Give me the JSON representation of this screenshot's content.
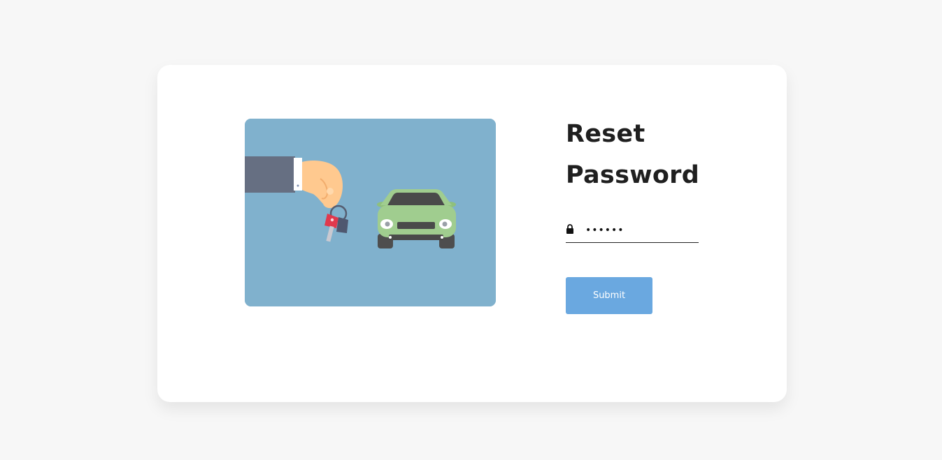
{
  "page": {
    "background": "#f7f7f7",
    "card_background": "#ffffff"
  },
  "illustration": {
    "name": "hand-holding-car-keys-illustration",
    "background": "#80b1cd"
  },
  "form": {
    "title_line1": "Reset",
    "title_line2": "Password",
    "password_icon": "lock-icon",
    "password_value": "••••••",
    "submit_label": "Submit",
    "submit_color": "#6aa8e0"
  }
}
